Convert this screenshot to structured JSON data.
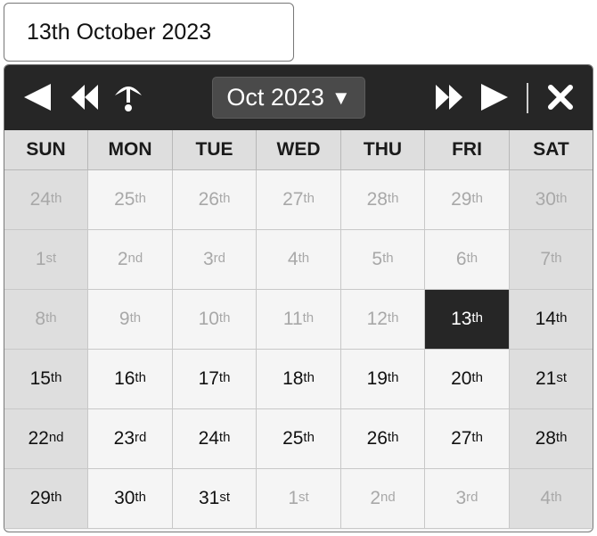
{
  "date_input": {
    "value": "13th October 2023"
  },
  "header": {
    "month_label": "Oct 2023",
    "caret": "▼"
  },
  "icons": {
    "prev_month": "triangle-left-icon",
    "prev_year": "double-chevron-left-icon",
    "today": "umbrella-icon",
    "next_year": "double-chevron-right-icon",
    "next_month": "triangle-right-icon",
    "close": "close-icon"
  },
  "weekdays": [
    "SUN",
    "MON",
    "TUE",
    "WED",
    "THU",
    "FRI",
    "SAT"
  ],
  "weeks": [
    [
      {
        "n": "24",
        "s": "th",
        "muted": true
      },
      {
        "n": "25",
        "s": "th",
        "muted": true
      },
      {
        "n": "26",
        "s": "th",
        "muted": true
      },
      {
        "n": "27",
        "s": "th",
        "muted": true
      },
      {
        "n": "28",
        "s": "th",
        "muted": true
      },
      {
        "n": "29",
        "s": "th",
        "muted": true
      },
      {
        "n": "30",
        "s": "th",
        "muted": true
      }
    ],
    [
      {
        "n": "1",
        "s": "st",
        "muted": true
      },
      {
        "n": "2",
        "s": "nd",
        "muted": true
      },
      {
        "n": "3",
        "s": "rd",
        "muted": true
      },
      {
        "n": "4",
        "s": "th",
        "muted": true
      },
      {
        "n": "5",
        "s": "th",
        "muted": true
      },
      {
        "n": "6",
        "s": "th",
        "muted": true
      },
      {
        "n": "7",
        "s": "th",
        "muted": true
      }
    ],
    [
      {
        "n": "8",
        "s": "th",
        "muted": true
      },
      {
        "n": "9",
        "s": "th",
        "muted": true
      },
      {
        "n": "10",
        "s": "th",
        "muted": true
      },
      {
        "n": "11",
        "s": "th",
        "muted": true
      },
      {
        "n": "12",
        "s": "th",
        "muted": true
      },
      {
        "n": "13",
        "s": "th",
        "selected": true
      },
      {
        "n": "14",
        "s": "th"
      }
    ],
    [
      {
        "n": "15",
        "s": "th"
      },
      {
        "n": "16",
        "s": "th"
      },
      {
        "n": "17",
        "s": "th"
      },
      {
        "n": "18",
        "s": "th"
      },
      {
        "n": "19",
        "s": "th"
      },
      {
        "n": "20",
        "s": "th"
      },
      {
        "n": "21",
        "s": "st"
      }
    ],
    [
      {
        "n": "22",
        "s": "nd"
      },
      {
        "n": "23",
        "s": "rd"
      },
      {
        "n": "24",
        "s": "th"
      },
      {
        "n": "25",
        "s": "th"
      },
      {
        "n": "26",
        "s": "th"
      },
      {
        "n": "27",
        "s": "th"
      },
      {
        "n": "28",
        "s": "th"
      }
    ],
    [
      {
        "n": "29",
        "s": "th"
      },
      {
        "n": "30",
        "s": "th"
      },
      {
        "n": "31",
        "s": "st"
      },
      {
        "n": "1",
        "s": "st",
        "muted": true
      },
      {
        "n": "2",
        "s": "nd",
        "muted": true
      },
      {
        "n": "3",
        "s": "rd",
        "muted": true
      },
      {
        "n": "4",
        "s": "th",
        "muted": true
      }
    ]
  ],
  "colors": {
    "header_bg": "#262626",
    "selected_bg": "#262626",
    "weekend_bg": "#dedede",
    "weekday_bg": "#f5f5f5",
    "muted_text": "#a8a8a8"
  }
}
